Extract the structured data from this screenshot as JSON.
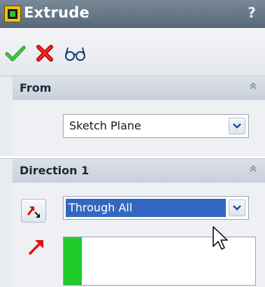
{
  "window": {
    "title": "Extrude",
    "help_label": "?"
  },
  "actions": {
    "ok_icon": "green-checkmark-icon",
    "cancel_icon": "red-x-icon",
    "preview_icon": "glasses-icon"
  },
  "from_section": {
    "title": "From",
    "start_condition": "Sketch Plane"
  },
  "direction1_section": {
    "title": "Direction 1",
    "end_condition": "Through All"
  },
  "colors": {
    "titlebar": "#5e6d80",
    "selection": "#3468c0",
    "accent_green": "#1ecb2a",
    "direction_arrow_red": "#e01010"
  }
}
